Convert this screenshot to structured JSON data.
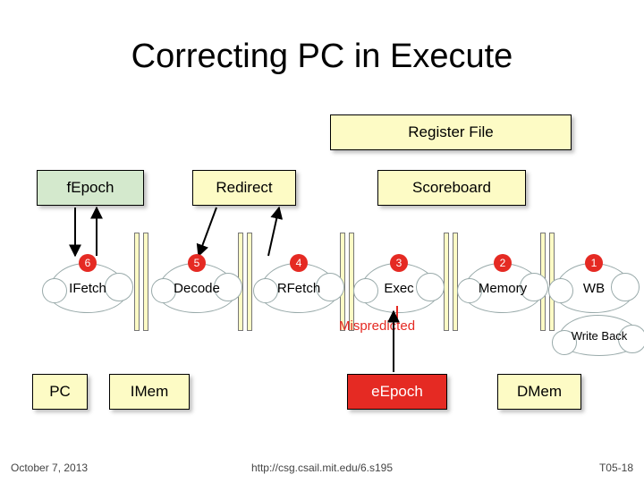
{
  "title": "Correcting PC in Execute",
  "boxes": {
    "regfile": "Register File",
    "fepoch": "fEpoch",
    "redirect": "Redirect",
    "scoreboard": "Scoreboard",
    "pc": "PC",
    "imem": "IMem",
    "eepoch": "eEpoch",
    "dmem": "DMem"
  },
  "stages": {
    "ifetch": {
      "num": "6",
      "label": "IFetch"
    },
    "decode": {
      "num": "5",
      "label": "Decode"
    },
    "rfetch": {
      "num": "4",
      "label": "RFetch"
    },
    "exec": {
      "num": "3",
      "label": "Exec"
    },
    "memory": {
      "num": "2",
      "label": "Memory"
    },
    "wb": {
      "num": "1",
      "label": "WB"
    }
  },
  "writeback_label": "Write Back",
  "mispredicted_label": "Mispredicted",
  "footer": {
    "date": "October 7, 2013",
    "url": "http://csg.csail.mit.edu/6.s195",
    "slide": "T05-18"
  }
}
